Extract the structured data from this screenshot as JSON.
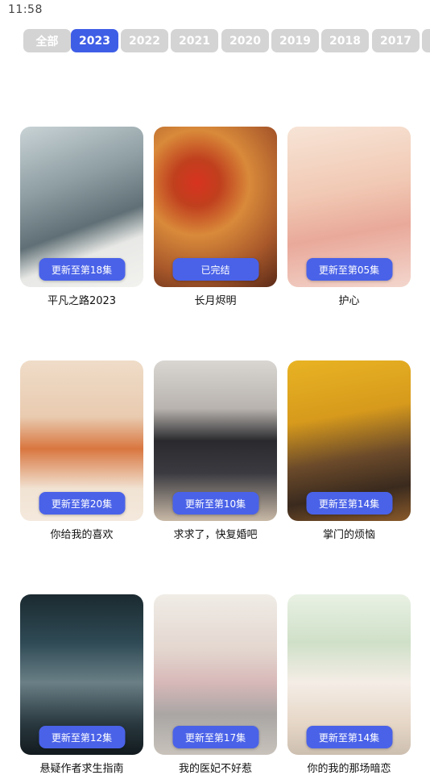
{
  "status_bar": {
    "time": "11:58"
  },
  "years": [
    "全部",
    "2023",
    "2022",
    "2021",
    "2020",
    "2019",
    "2018",
    "2017",
    ""
  ],
  "active_year_index": 1,
  "shows": [
    {
      "title": "平凡之路2023",
      "badge": "更新至第18集"
    },
    {
      "title": "长月烬明",
      "badge": "已完结"
    },
    {
      "title": "护心",
      "badge": "更新至第05集"
    },
    {
      "title": "你给我的喜欢",
      "badge": "更新至第20集"
    },
    {
      "title": "求求了，快复婚吧",
      "badge": "更新至第10集"
    },
    {
      "title": "掌门的烦恼",
      "badge": "更新至第14集"
    },
    {
      "title": "悬疑作者求生指南",
      "badge": "更新至第12集"
    },
    {
      "title": "我的医妃不好惹",
      "badge": "更新至第17集"
    },
    {
      "title": "你的我的那场暗恋",
      "badge": "更新至第14集"
    }
  ],
  "colors": {
    "accent": "#3f5ee6",
    "chip_inactive": "#d4d4d4"
  }
}
